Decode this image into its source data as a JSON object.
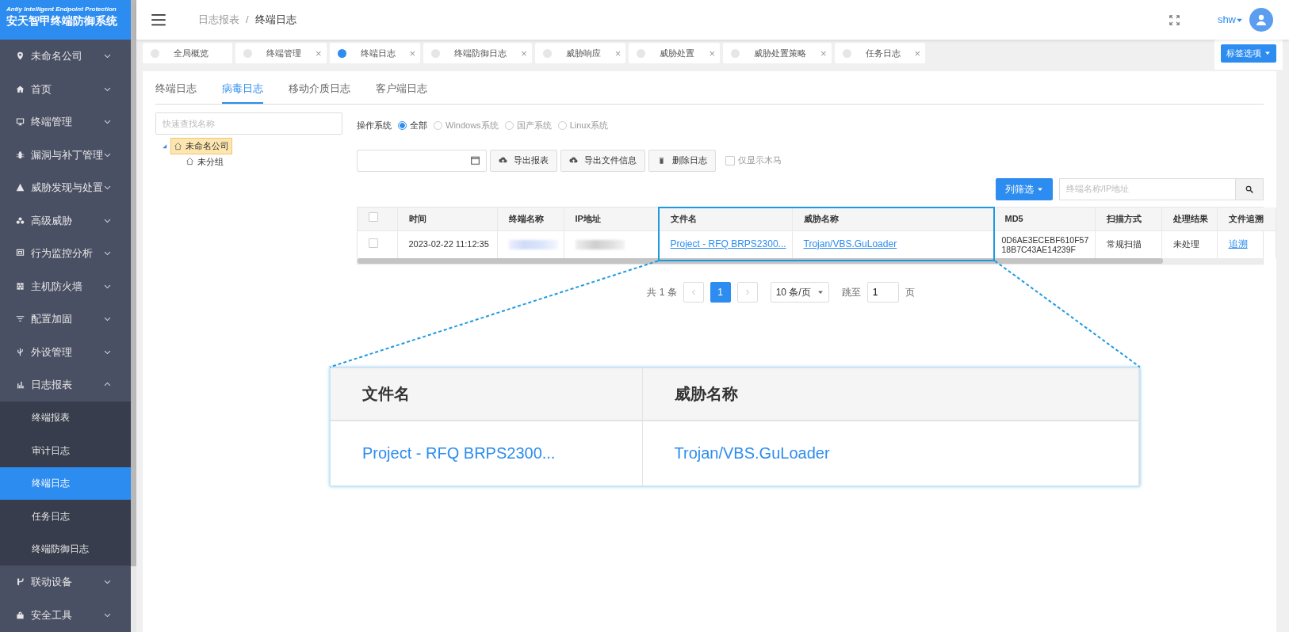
{
  "app": {
    "subtitle": "Antiy Intelligent Endpoint Protection",
    "title": "安天智甲终端防御系统"
  },
  "sidebar": {
    "items": [
      {
        "label": "未命名公司",
        "expanded": false
      },
      {
        "label": "首页",
        "expanded": false
      },
      {
        "label": "终端管理",
        "expanded": false
      },
      {
        "label": "漏洞与补丁管理",
        "expanded": false
      },
      {
        "label": "威胁发现与处置",
        "expanded": false
      },
      {
        "label": "高级威胁",
        "expanded": false
      },
      {
        "label": "行为监控分析",
        "expanded": false
      },
      {
        "label": "主机防火墙",
        "expanded": false
      },
      {
        "label": "配置加固",
        "expanded": false
      },
      {
        "label": "外设管理",
        "expanded": false
      },
      {
        "label": "日志报表",
        "expanded": true,
        "children": [
          {
            "label": "终端报表",
            "selected": false
          },
          {
            "label": "审计日志",
            "selected": false
          },
          {
            "label": "终端日志",
            "selected": true
          },
          {
            "label": "任务日志",
            "selected": false
          },
          {
            "label": "终端防御日志",
            "selected": false
          }
        ]
      },
      {
        "label": "联动设备",
        "expanded": false
      },
      {
        "label": "安全工具",
        "expanded": false
      }
    ]
  },
  "header": {
    "breadcrumb": [
      "日志报表",
      "终端日志"
    ],
    "separator": "/",
    "user": "shw"
  },
  "page_tabs": [
    {
      "label": "全局概览",
      "selected": false
    },
    {
      "label": "终端管理",
      "selected": false,
      "close": "×"
    },
    {
      "label": "终端日志",
      "selected": true,
      "close": "×"
    },
    {
      "label": "终端防御日志",
      "selected": false,
      "close": "×"
    },
    {
      "label": "威胁响应",
      "selected": false,
      "close": "×"
    },
    {
      "label": "威胁处置",
      "selected": false,
      "close": "×"
    },
    {
      "label": "威胁处置策略",
      "selected": false,
      "close": "×"
    },
    {
      "label": "任务日志",
      "selected": false,
      "close": "×"
    }
  ],
  "tab_options_button": "标签选项",
  "log_tabs": [
    {
      "label": "终端日志",
      "selected": false
    },
    {
      "label": "病毒日志",
      "selected": true
    },
    {
      "label": "移动介质日志",
      "selected": false
    },
    {
      "label": "客户端日志",
      "selected": false
    }
  ],
  "tree": {
    "search_placeholder": "快速查找名称",
    "nodes": [
      {
        "label": "未命名公司",
        "selected": true,
        "expanded": true,
        "children": [
          {
            "label": "未分组",
            "selected": false
          }
        ]
      }
    ]
  },
  "os_filter": {
    "label": "操作系统",
    "options": [
      {
        "label": "全部",
        "selected": true
      },
      {
        "label": "Windows系统",
        "selected": false
      },
      {
        "label": "国产系统",
        "selected": false
      },
      {
        "label": "Linux系统",
        "selected": false
      }
    ]
  },
  "toolbar": {
    "buttons": [
      "导出报表",
      "导出文件信息",
      "删除日志"
    ],
    "trojan_only": {
      "label": "仅显示木马",
      "checked": false
    }
  },
  "column_filter_button": "列筛选",
  "search_placeholder": "终端名称/IP地址",
  "table": {
    "columns": [
      {
        "kind": "check",
        "checked": false
      },
      {
        "label": "时间",
        "highlighted": false
      },
      {
        "label": "终端名称",
        "highlighted": false
      },
      {
        "label": "IP地址",
        "highlighted": false
      },
      {
        "label": "文件名",
        "highlighted": true
      },
      {
        "label": "威胁名称",
        "highlighted": true
      },
      {
        "label": "MD5",
        "highlighted": false
      },
      {
        "label": "扫描方式",
        "highlighted": false
      },
      {
        "label": "处理结果",
        "highlighted": false
      },
      {
        "label": "文件追溯",
        "highlighted": false
      }
    ],
    "rows": [
      {
        "checked": false,
        "cells": [
          {
            "kind": "check"
          },
          {
            "kind": "text",
            "text": "2023-02-22 11:12:35"
          },
          {
            "kind": "redacted"
          },
          {
            "kind": "redacted"
          },
          {
            "kind": "link",
            "text": "Project - RFQ BRPS2300..."
          },
          {
            "kind": "link",
            "text": "Trojan/VBS.GuLoader"
          },
          {
            "kind": "text",
            "text": "0D6AE3ECEBF610F5718B7C43AE14239F"
          },
          {
            "kind": "text",
            "text": "常规扫描"
          },
          {
            "kind": "text",
            "text": "未处理"
          },
          {
            "kind": "link",
            "text": "追溯"
          }
        ]
      }
    ]
  },
  "pagination": {
    "total": "共 1 条",
    "pages": [
      {
        "label": "1",
        "selected": true
      }
    ],
    "page_size": "10 条/页",
    "jump_label": "跳至",
    "jump_value": "1",
    "unit": "页"
  },
  "callout": {
    "columns": [
      "文件名",
      "威胁名称"
    ],
    "cells": [
      "Project - RFQ BRPS2300...",
      "Trojan/VBS.GuLoader"
    ]
  }
}
